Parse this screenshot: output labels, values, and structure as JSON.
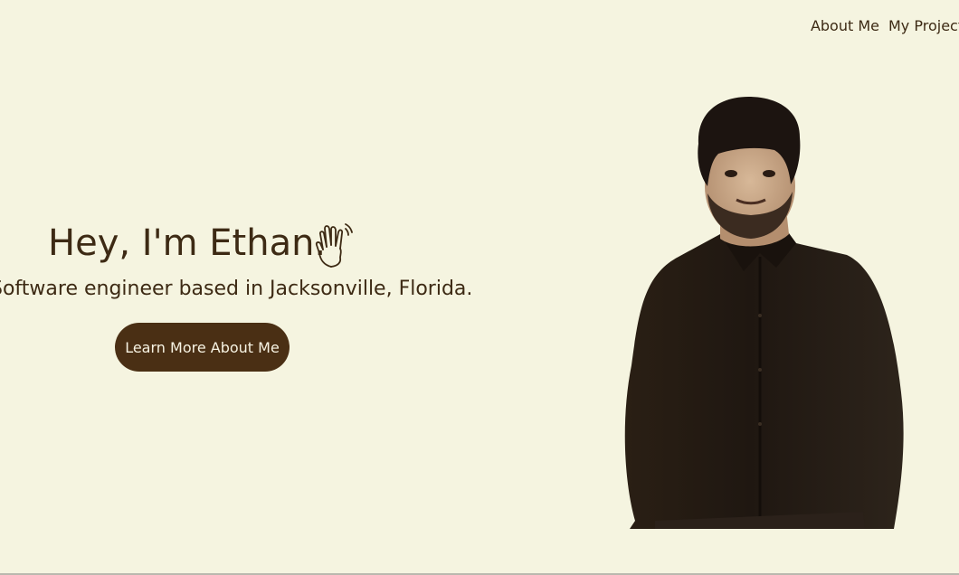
{
  "nav": {
    "about": "About Me",
    "projects": "My Projects"
  },
  "hero": {
    "title": "Hey, I'm Ethan.",
    "subtitle": "Software engineer based in Jacksonville, Florida.",
    "cta": "Learn More About Me",
    "icon": "waving-hand-icon"
  },
  "colors": {
    "background": "#f5f4e0",
    "text": "#3d2a14",
    "button_bg": "#4a2f14",
    "button_text": "#f7f3e3"
  }
}
